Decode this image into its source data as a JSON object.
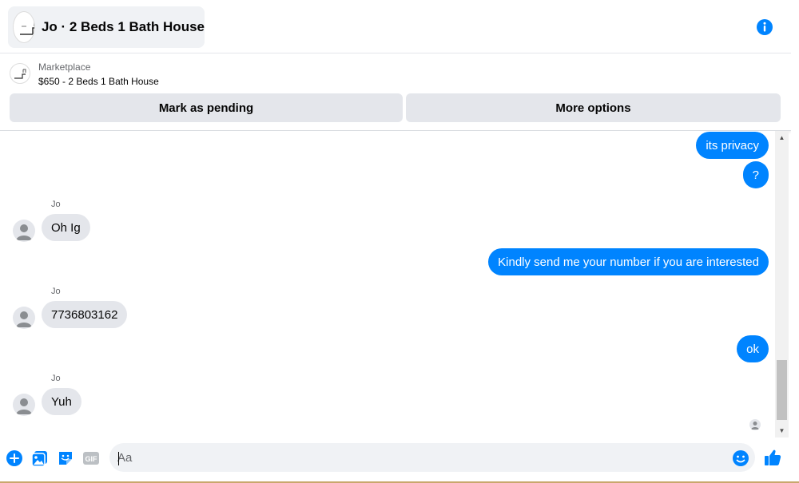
{
  "header": {
    "title": "Jo · 2 Beds 1 Bath House",
    "info_icon": "info-icon"
  },
  "listing": {
    "label": "Marketplace",
    "price_title": "$650 - 2 Beds 1 Bath House",
    "mark_pending_label": "Mark as pending",
    "more_options_label": "More options"
  },
  "messages": [
    {
      "direction": "out",
      "text": "its privacy"
    },
    {
      "direction": "out",
      "text": "?"
    },
    {
      "direction": "in",
      "sender": "Jo",
      "text": "Oh Ig"
    },
    {
      "direction": "out",
      "text": "Kindly send me your number if you are interested"
    },
    {
      "direction": "in",
      "sender": "Jo",
      "text": "7736803162"
    },
    {
      "direction": "out",
      "text": "ok"
    },
    {
      "direction": "in",
      "sender": "Jo",
      "text": "Yuh"
    }
  ],
  "composer": {
    "placeholder": "Aa",
    "icons": [
      "plus-circle-icon",
      "photo-icon",
      "sticker-icon",
      "gif-icon",
      "emoji-icon",
      "thumbs-up-icon"
    ]
  },
  "colors": {
    "accent": "#0084ff",
    "incoming_bubble": "#e4e6eb",
    "outgoing_text": "#ffffff"
  }
}
